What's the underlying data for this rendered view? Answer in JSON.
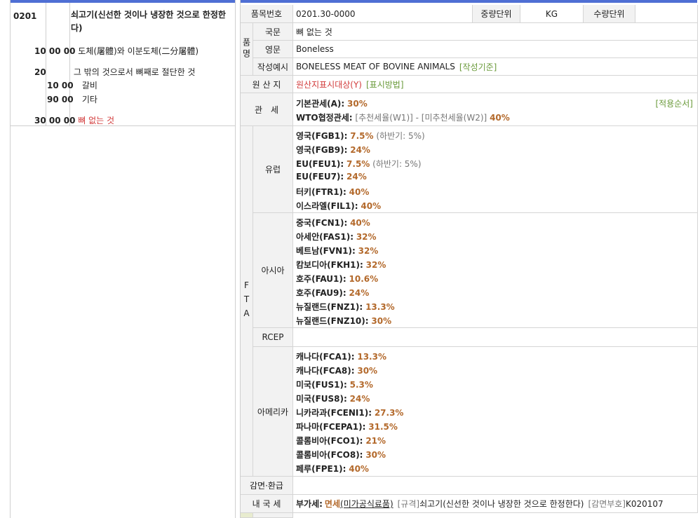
{
  "left": {
    "heading_code": "0201",
    "heading_desc": "쇠고기(신선한 것이나 냉장한 것으로 한정한다)",
    "rows": [
      {
        "code": "10 00 00",
        "desc": "도체(屠體)와 이분도체(二分屠體)"
      },
      {
        "code": "20",
        "desc": "그 밖의 것으로서 뼈째로 절단한 것"
      },
      {
        "code": "10 00",
        "desc": "갈비"
      },
      {
        "code": "90 00",
        "desc": "기타"
      },
      {
        "code": "30 00 00",
        "desc": "뼈 없는 것"
      }
    ]
  },
  "right": {
    "item_no_label": "품목번호",
    "item_no": "0201.30-0000",
    "weight_unit_label": "중량단위",
    "weight_unit": "KG",
    "qty_unit_label": "수량단위",
    "qty_unit": "",
    "name_group_label": "품명",
    "korean_label": "국문",
    "korean_name": "뼈 없는 것",
    "english_label": "영문",
    "english_name": "Boneless",
    "example_label": "작성예시",
    "example_text": "BONELESS MEAT OF BOVINE ANIMALS",
    "example_link": "[작성기준]",
    "origin_label": "원 산 지",
    "origin_value": "원산지표시대상(Y)",
    "origin_link": "[표시방법]",
    "tariff_label": "관　세",
    "tariff_basic_label": "기본관세(A):",
    "tariff_basic_rate": "30%",
    "tariff_order_link": "[적용순서]",
    "tariff_wto_label": "WTO협정관세:",
    "tariff_wto_w1": "[추천세율(W1)] -",
    "tariff_wto_w2": "[미추천세율(W2)]",
    "tariff_wto_rate": "40%",
    "fta_label": "FTA",
    "fta_groups": [
      {
        "name": "유럽",
        "items": [
          {
            "label": "영국(FGB1):",
            "rate": "7.5%",
            "note": "(하반기: 5%)"
          },
          {
            "label": "영국(FGB9):",
            "rate": "24%",
            "note": ""
          },
          {
            "label": "EU(FEU1):",
            "rate": "7.5%",
            "note": "(하반기: 5%)"
          },
          {
            "label": "EU(FEU7):",
            "rate": "24%",
            "note": ""
          },
          {
            "label": "터키(FTR1):",
            "rate": "40%",
            "note": ""
          },
          {
            "label": "이스라엘(FIL1):",
            "rate": "40%",
            "note": ""
          }
        ]
      },
      {
        "name": "아시아",
        "items": [
          {
            "label": "중국(FCN1):",
            "rate": "40%",
            "note": ""
          },
          {
            "label": "아세안(FAS1):",
            "rate": "32%",
            "note": ""
          },
          {
            "label": "베트남(FVN1):",
            "rate": "32%",
            "note": ""
          },
          {
            "label": "캄보디아(FKH1):",
            "rate": "32%",
            "note": ""
          },
          {
            "label": "호주(FAU1):",
            "rate": "10.6%",
            "note": ""
          },
          {
            "label": "호주(FAU9):",
            "rate": "24%",
            "note": ""
          },
          {
            "label": "뉴질랜드(FNZ1):",
            "rate": "13.3%",
            "note": ""
          },
          {
            "label": "뉴질랜드(FNZ10):",
            "rate": "30%",
            "note": ""
          }
        ]
      },
      {
        "name": "RCEP",
        "items": []
      },
      {
        "name": "아메리카",
        "items": [
          {
            "label": "캐나다(FCA1):",
            "rate": "13.3%",
            "note": ""
          },
          {
            "label": "캐나다(FCA8):",
            "rate": "30%",
            "note": ""
          },
          {
            "label": "미국(FUS1):",
            "rate": "5.3%",
            "note": ""
          },
          {
            "label": "미국(FUS8):",
            "rate": "24%",
            "note": ""
          },
          {
            "label": "니카라과(FCENI1):",
            "rate": "27.3%",
            "note": ""
          },
          {
            "label": "파나마(FCEPA1):",
            "rate": "31.5%",
            "note": ""
          },
          {
            "label": "콜롬비아(FCO1):",
            "rate": "21%",
            "note": ""
          },
          {
            "label": "콜롬비아(FCO8):",
            "rate": "30%",
            "note": ""
          },
          {
            "label": "페루(FPE1):",
            "rate": "40%",
            "note": ""
          }
        ]
      }
    ],
    "reduction_label": "감면·환급",
    "domestic_label": "내 국 세",
    "domestic_vat_label": "부가세:",
    "domestic_vat_value": "면세",
    "domestic_vat_link": "(미가공식료품)",
    "domestic_spec_label": "[규격]",
    "domestic_spec": "쇠고기(신선한 것이나 냉장한 것으로 한정한다)",
    "domestic_code_label": "[감면부호]",
    "domestic_code": "K020107"
  }
}
